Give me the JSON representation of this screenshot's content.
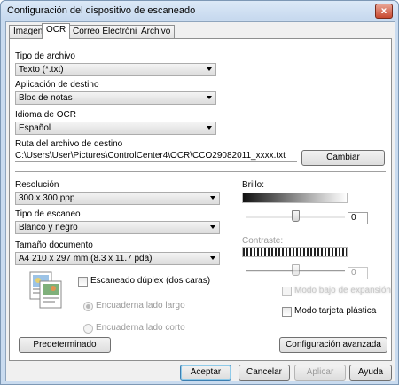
{
  "window": {
    "title": "Configuración del dispositivo de escaneado",
    "close_glyph": "x"
  },
  "tabs": [
    {
      "label": "Imagen",
      "active": false
    },
    {
      "label": "OCR",
      "active": true
    },
    {
      "label": "Correo Electrónico",
      "active": false
    },
    {
      "label": "Archivo",
      "active": false
    }
  ],
  "ocr": {
    "file_type": {
      "label": "Tipo de archivo",
      "value": "Texto (*.txt)"
    },
    "target_app": {
      "label": "Aplicación de destino",
      "value": "Bloc de notas"
    },
    "ocr_language": {
      "label": "Idioma de OCR",
      "value": "Español"
    },
    "dest_path": {
      "label": "Ruta del archivo de destino",
      "value": "C:\\Users\\User\\Pictures\\ControlCenter4\\OCR\\CCO29082011_xxxx.txt",
      "change_button": "Cambiar"
    }
  },
  "scan": {
    "resolution": {
      "label": "Resolución",
      "value": "300 x 300 ppp"
    },
    "scan_type": {
      "label": "Tipo de escaneo",
      "value": "Blanco y negro"
    },
    "document_size": {
      "label": "Tamaño documento",
      "value": "A4 210 x 297 mm (8.3 x 11.7 pda)"
    },
    "brightness": {
      "label": "Brillo:",
      "value": "0",
      "level": 0.5
    },
    "contrast": {
      "label": "Contraste:",
      "value": "0",
      "level": 0.5,
      "enabled": false
    },
    "duplex": {
      "label": "Escaneado dúplex (dos caras)",
      "checked": false
    },
    "long_edge": {
      "label": "Encuaderna lado largo",
      "checked": true,
      "enabled": false
    },
    "short_edge": {
      "label": "Encuaderna lado corto",
      "checked": false,
      "enabled": false
    },
    "blurred_option": {
      "label": "Modo bajo de expansión",
      "enabled": false
    },
    "plastic_card": {
      "label": "Modo tarjeta plástica",
      "checked": false
    }
  },
  "buttons": {
    "default": "Predeterminado",
    "advanced": "Configuración avanzada",
    "accept": "Aceptar",
    "cancel": "Cancelar",
    "apply": "Aplicar",
    "help": "Ayuda"
  },
  "colors": {
    "accent": "#3c7fb1",
    "title_bar": "#c6d8ee",
    "close": "#c8492f"
  }
}
